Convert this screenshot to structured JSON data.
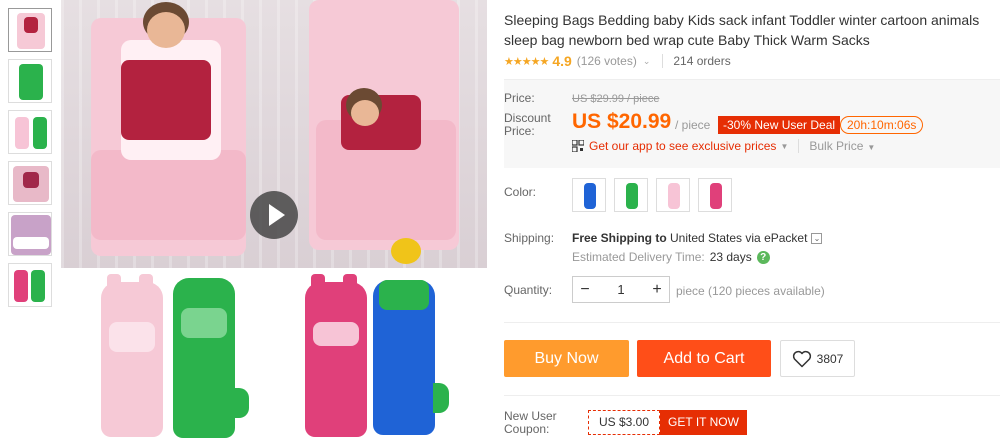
{
  "product": {
    "title": "Sleeping Bags Bedding baby Kids sack infant Toddler winter cartoon animals sleep bag newborn bed wrap cute Baby Thick Warm Sacks",
    "stars": "★★★★★",
    "rating": "4.9",
    "rating_value": 4.9,
    "votes": "(126 votes)",
    "orders": "214 orders"
  },
  "thumbnails": [
    {
      "name": "thumb-1",
      "icon": "photo-pink-bag-child"
    },
    {
      "name": "thumb-2",
      "icon": "photo-green-dino-bag"
    },
    {
      "name": "thumb-3",
      "icon": "photo-pink-green-bags"
    },
    {
      "name": "thumb-4",
      "icon": "photo-child-in-bag"
    },
    {
      "name": "thumb-5",
      "icon": "photo-bag-detail"
    },
    {
      "name": "thumb-6",
      "icon": "photo-pink-green-bags-2"
    }
  ],
  "pricing": {
    "price_label": "Price:",
    "old_price": "US $29.99 / piece",
    "discount_label": "Discount Price:",
    "new_price": "US $20.99",
    "per_unit": "/ piece",
    "deal_badge": "-30% New User Deal",
    "timer": "20h:10m:06s",
    "app_link": "Get our app to see exclusive prices",
    "bulk_price": "Bulk Price"
  },
  "options": {
    "color_label": "Color:",
    "colors": [
      "#1f63d6",
      "#2bb24c",
      "#f7c4d6",
      "#e0407a"
    ],
    "shipping_label": "Shipping:",
    "shipping_free": "Free Shipping to",
    "shipping_dest": "United States via ePacket",
    "delivery_label": "Estimated Delivery Time:",
    "delivery_days": "23 days",
    "quantity_label": "Quantity:",
    "quantity_minus": "−",
    "quantity_value": "1",
    "quantity_plus": "+",
    "quantity_note": "piece (120 pieces available)"
  },
  "actions": {
    "buy_now": "Buy Now",
    "add_to_cart": "Add to Cart",
    "wishlist_count": "3807"
  },
  "coupon": {
    "label": "New User Coupon:",
    "value": "US $3.00",
    "button": "GET IT NOW"
  },
  "colors": {
    "accent": "#ff4e18",
    "buy": "#ff9b2d",
    "price": "#ff6600",
    "badge": "#e62e04",
    "star": "#f5a623"
  }
}
